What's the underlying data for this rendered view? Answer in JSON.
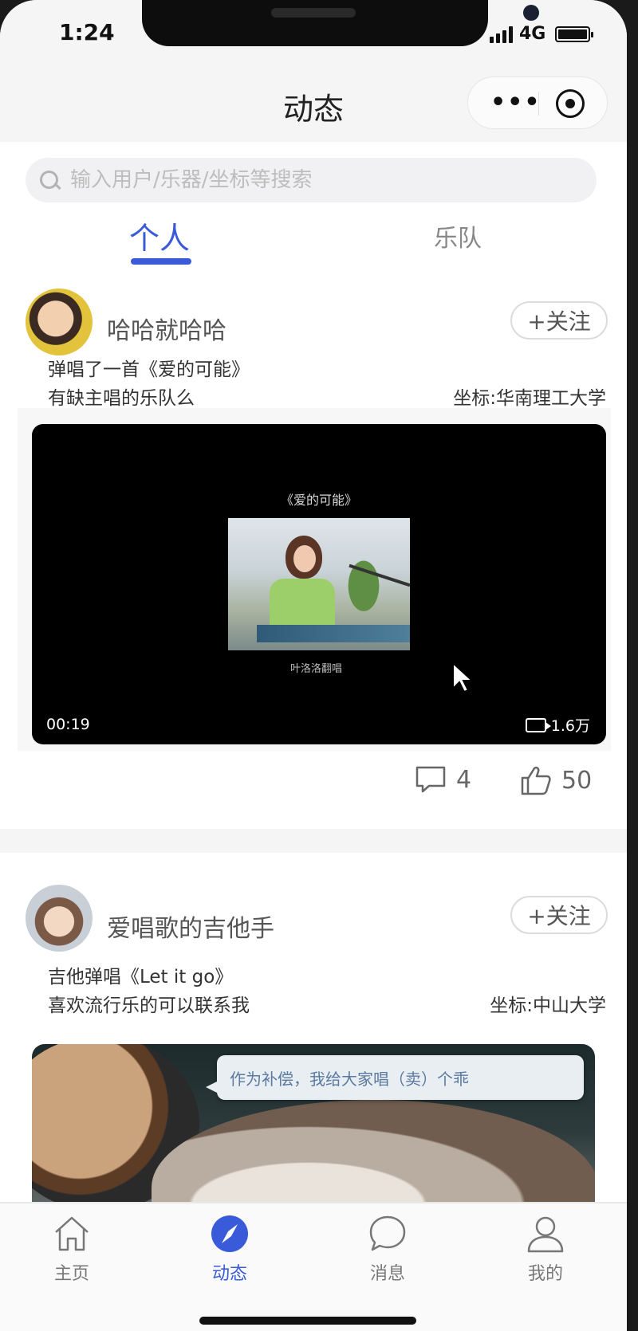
{
  "status_bar": {
    "time": "1:24",
    "network": "4G"
  },
  "navbar": {
    "title": "动态",
    "more_icon": "more-dots-icon",
    "target_icon": "target-icon"
  },
  "search": {
    "placeholder": "输入用户/乐器/坐标等搜索",
    "value": "",
    "icon": "search-icon"
  },
  "tabs": [
    {
      "label": "个人",
      "active": true
    },
    {
      "label": "乐队",
      "active": false
    }
  ],
  "posts": [
    {
      "username": "哈哈就哈哈",
      "follow_label": "+关注",
      "line1": "弹唱了一首《爱的可能》",
      "line2": "有缺主唱的乐队么",
      "location": "坐标:华南理工大学",
      "video": {
        "title_overlay": "《爱的可能》",
        "subtitle_overlay": "叶洛洛翻唱",
        "duration": "00:19",
        "views": "1.6万"
      },
      "comments": "4",
      "likes": "50"
    },
    {
      "username": "爱唱歌的吉他手",
      "follow_label": "+关注",
      "line1": "吉他弹唱《Let it go》",
      "line2": "喜欢流行乐的可以联系我",
      "location": "坐标:中山大学",
      "video": {
        "speech_text": "作为补偿，我给大家唱（卖）个乖"
      }
    }
  ],
  "tabbar": [
    {
      "label": "主页",
      "icon": "home-icon",
      "active": false
    },
    {
      "label": "动态",
      "icon": "compass-icon",
      "active": true
    },
    {
      "label": "消息",
      "icon": "chat-bubble-icon",
      "active": false
    },
    {
      "label": "我的",
      "icon": "user-icon",
      "active": false
    }
  ],
  "colors": {
    "accent": "#3a5bd9",
    "background": "#ffffff",
    "header": "#f5f5f5"
  }
}
